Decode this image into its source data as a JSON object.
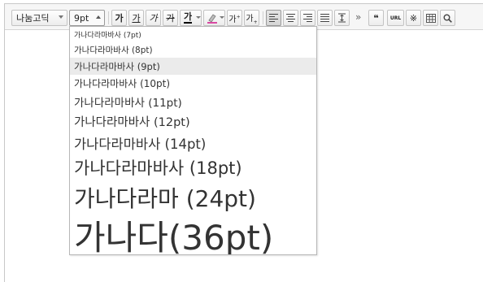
{
  "toolbar": {
    "font_combo": {
      "value": "나눔고딕"
    },
    "size_combo": {
      "value": "9pt"
    },
    "bold_glyph": "가",
    "underline_glyph": "가",
    "italic_glyph": "가",
    "strike_glyph": "가",
    "font_color_glyph": "가",
    "superscript_glyph": "가",
    "subscript_glyph": "가",
    "more_glyph": "»",
    "quote_glyph": "❝",
    "url_label": "URL",
    "special_char_glyph": "※",
    "search_glyph": "🔍"
  },
  "font_size_dropdown": {
    "selected_index": 2,
    "options": [
      {
        "label": "가나다라마바사 (7pt)"
      },
      {
        "label": "가나다라마바사 (8pt)"
      },
      {
        "label": "가나다라마바사 (9pt)"
      },
      {
        "label": "가나다라마바사 (10pt)"
      },
      {
        "label": "가나다라마바사 (11pt)"
      },
      {
        "label": "가나다라마바사 (12pt)"
      },
      {
        "label": "가나다라마바사 (14pt)"
      },
      {
        "label": "가나다라마바사 (18pt)"
      },
      {
        "label": "가나다라마 (24pt)"
      },
      {
        "label": "가나다(36pt)"
      }
    ]
  }
}
